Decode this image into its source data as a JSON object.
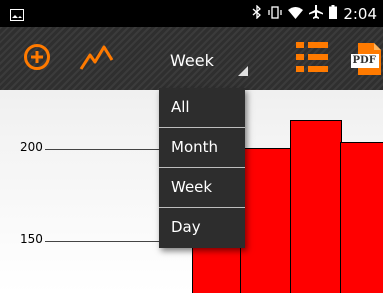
{
  "status_bar": {
    "time": "2:04",
    "icons": [
      "image-notification-icon",
      "bluetooth-icon",
      "vibrate-icon",
      "wifi-icon",
      "airplane-icon",
      "battery-icon"
    ]
  },
  "toolbar": {
    "add_icon": "add-circle-icon",
    "trend_icon": "trend-line-icon",
    "list_icon": "list-icon",
    "pdf_icon": "pdf-icon",
    "pdf_text": "PDF",
    "accent_color": "#ff7a00"
  },
  "period_select": {
    "selected": "Week",
    "options": [
      "All",
      "Month",
      "Week",
      "Day"
    ]
  },
  "chart_data": {
    "type": "bar",
    "y_ticks": [
      "200",
      "150"
    ],
    "bar_color": "#ff0000"
  }
}
